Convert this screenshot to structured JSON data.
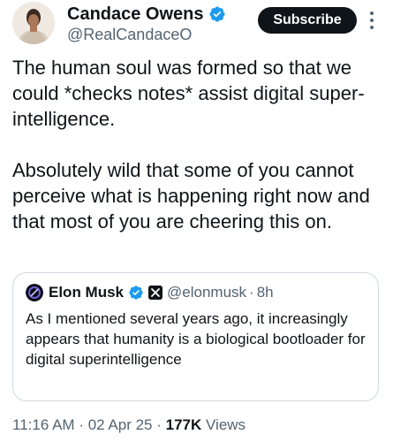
{
  "author": {
    "display_name": "Candace Owens",
    "handle": "@RealCandaceO",
    "verified_icon": "verified-badge-icon",
    "avatar_icon": "profile-photo"
  },
  "actions": {
    "subscribe_label": "Subscribe",
    "more_icon": "more-options-icon"
  },
  "tweet": {
    "paragraph_1": "The human soul was formed so that we could *checks notes* assist digital super-intelligence.",
    "paragraph_2": "Absolutely wild that some of you cannot perceive what is happening right now and that most of you are cheering this on."
  },
  "quote": {
    "display_name": "Elon Musk",
    "handle": "@elonmusk",
    "separator": "·",
    "time": "8h",
    "text": "As I mentioned several years ago, it increasingly appears that humanity is a biological bootloader for digital superintelligence"
  },
  "meta": {
    "time": "11:16 AM",
    "separator": "·",
    "date": "02 Apr 25",
    "views_count": "177K",
    "views_label": "Views"
  },
  "colors": {
    "verified_blue": "#1d9bf0",
    "text_primary": "#0f1419",
    "text_secondary": "#536471",
    "border": "#cfd9de",
    "button_bg": "#0f1419"
  }
}
